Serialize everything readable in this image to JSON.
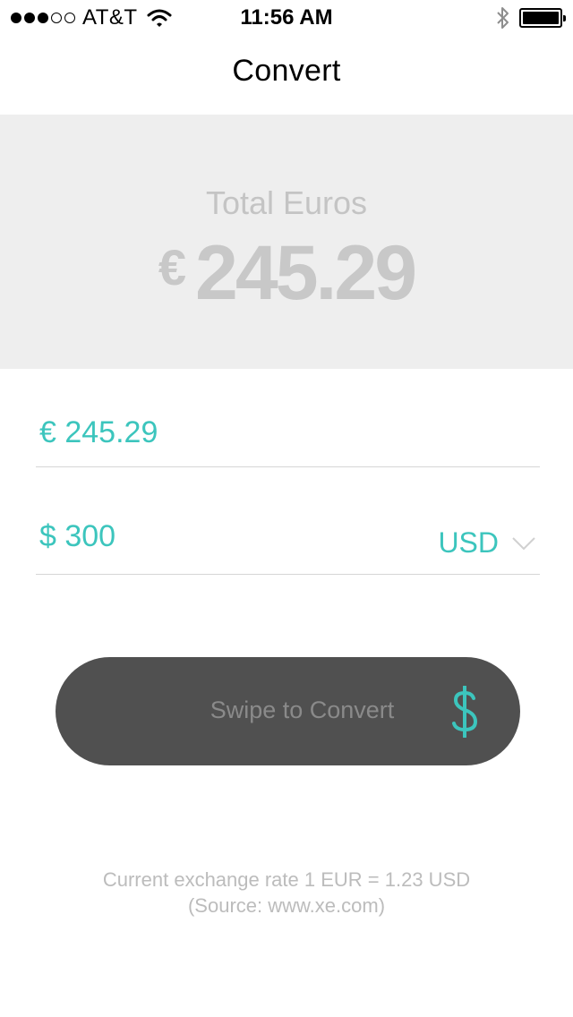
{
  "status_bar": {
    "carrier": "AT&T",
    "time": "11:56 AM",
    "signal_bars_filled": 3,
    "signal_bars_total": 5
  },
  "nav": {
    "title": "Convert"
  },
  "summary": {
    "label": "Total Euros",
    "symbol": "€",
    "value": "245.29"
  },
  "eur_field": {
    "value": "€ 245.29"
  },
  "usd_field": {
    "value": "$ 300",
    "currency": "USD"
  },
  "swipe": {
    "label": "Swipe to Convert",
    "icon": "dollar-icon"
  },
  "footer": {
    "rate": "Current exchange rate 1 EUR = 1.23 USD",
    "source": "(Source: www.xe.com)"
  },
  "colors": {
    "accent": "#3cc5bd",
    "panel": "#eeeeee",
    "button": "#505050"
  }
}
